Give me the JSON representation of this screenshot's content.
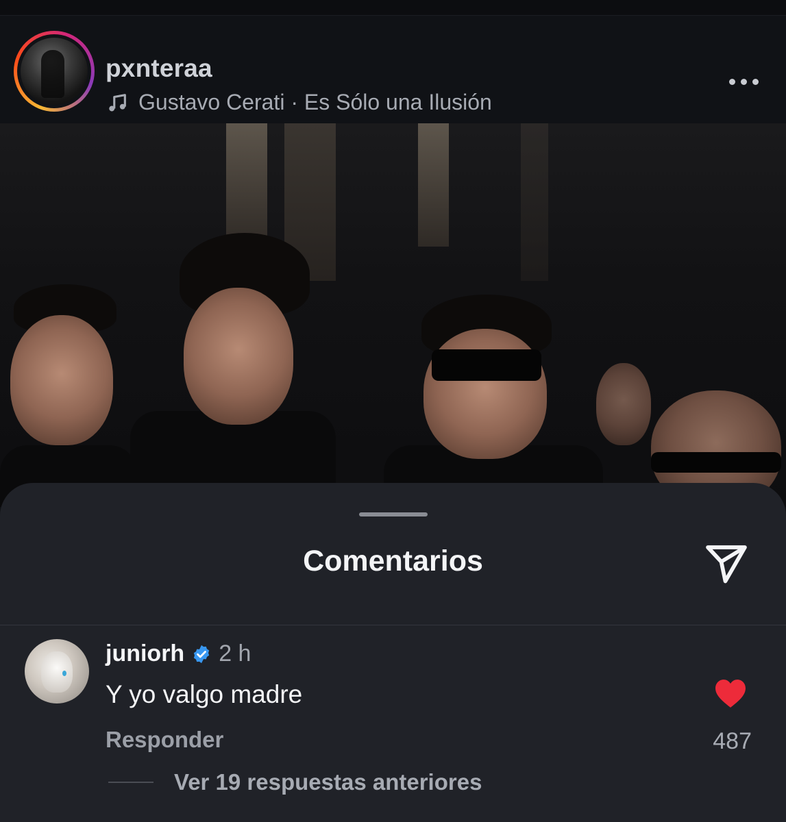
{
  "post": {
    "username": "pxnteraa",
    "audio": "Gustavo Cerati · Es Sólo una Ilusión"
  },
  "comments_sheet": {
    "title": "Comentarios"
  },
  "comment": {
    "username": "juniorh",
    "time": "2 h",
    "text": "Y yo valgo madre",
    "reply_label": "Responder",
    "like_count": "487",
    "view_replies_label": "Ver 19 respuestas anteriores"
  },
  "icons": {
    "music": "music-note-icon",
    "more": "more-horizontal-icon",
    "share": "send-icon",
    "verified": "verified-badge-icon",
    "heart": "heart-filled-icon"
  },
  "colors": {
    "background": "#0f1115",
    "sheet": "#202228",
    "verified_blue": "#3897f0",
    "heart_red": "#ed2b3a"
  }
}
